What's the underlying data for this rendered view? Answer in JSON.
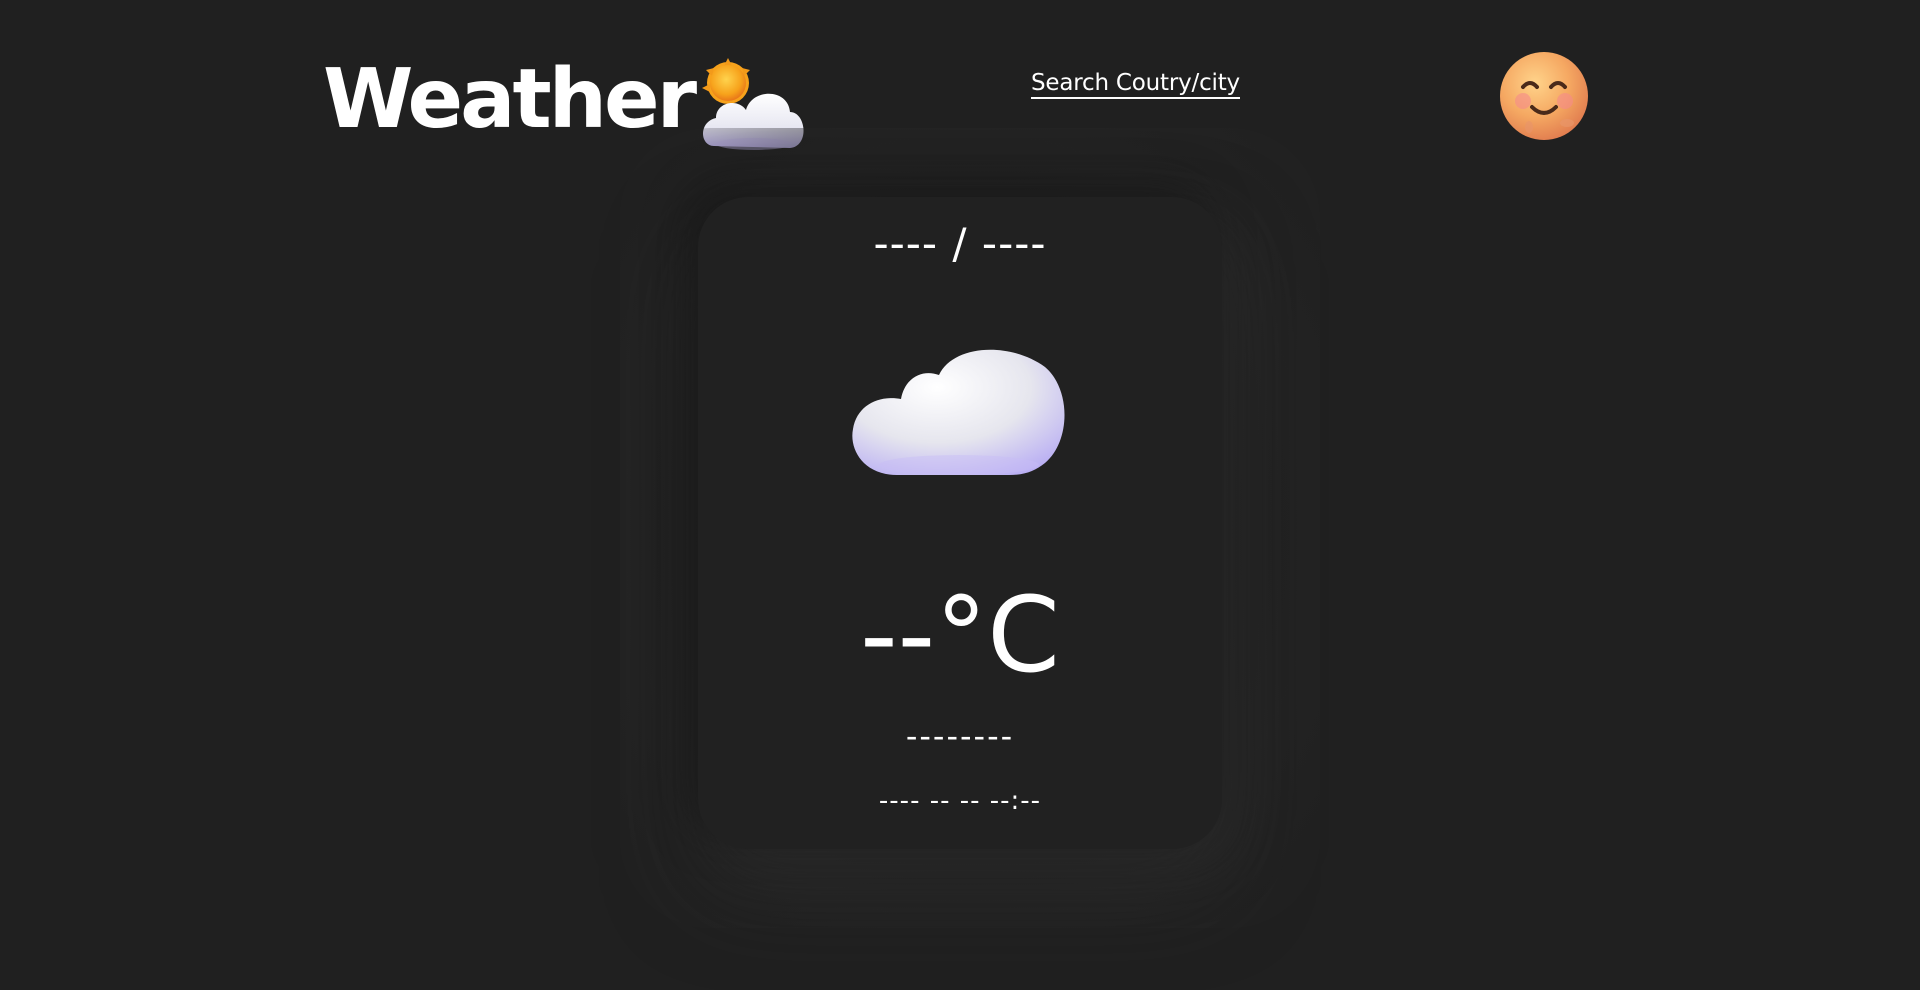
{
  "header": {
    "title": "Weather",
    "title_icon": "sun-behind-cloud-icon",
    "search_link": "Search Coutry/city",
    "avatar_icon": "smiling-face-avatar-icon"
  },
  "card": {
    "location": "---- / ----",
    "weather_icon": "cloud-icon",
    "temperature": "--°C",
    "condition": "--------",
    "datetime": "---- -- -- --:--"
  }
}
